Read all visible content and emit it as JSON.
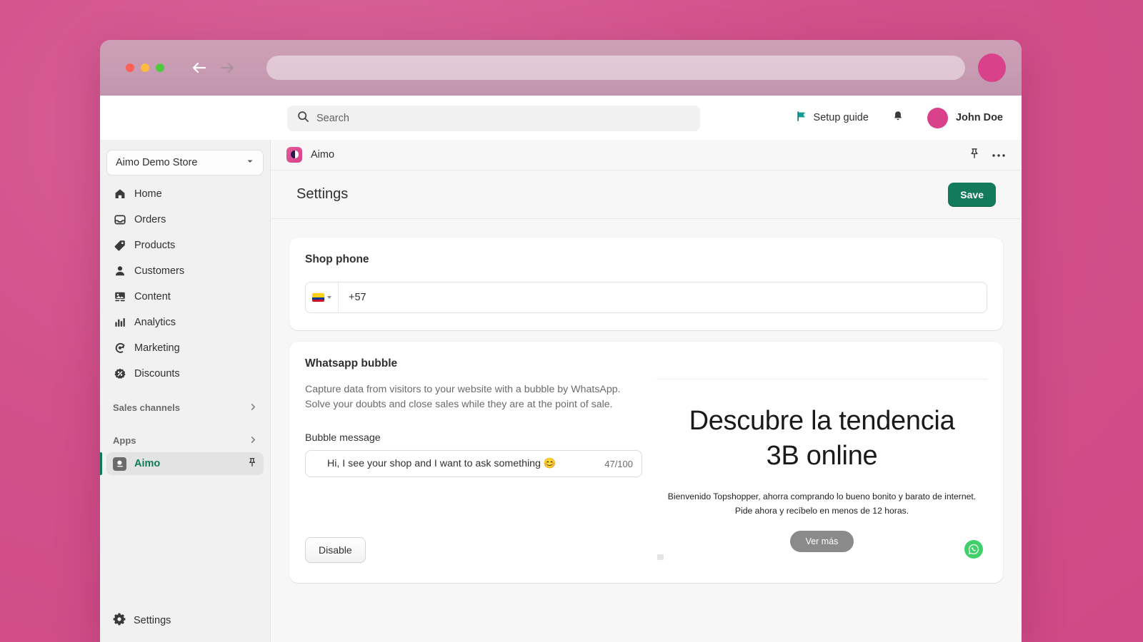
{
  "browser": {
    "back_arrow_icon": "arrow-left-icon",
    "forward_arrow_icon": "arrow-right-icon",
    "url_value": "",
    "url_placeholder": ""
  },
  "topbar": {
    "search": {
      "placeholder": "Search",
      "value": "",
      "icon": "search-icon"
    },
    "setup_guide_label": "Setup guide",
    "setup_guide_icon": "flag-icon",
    "notifications_icon": "bell-icon",
    "user_name": "John Doe",
    "avatar_color": "#d9418a"
  },
  "sidebar": {
    "store_selector": {
      "label": "Aimo Demo Store",
      "chevron_icon": "chevron-down-icon"
    },
    "items": [
      {
        "label": "Home",
        "icon": "home-icon"
      },
      {
        "label": "Orders",
        "icon": "orders-inbox-icon"
      },
      {
        "label": "Products",
        "icon": "tag-icon"
      },
      {
        "label": "Customers",
        "icon": "person-icon"
      },
      {
        "label": "Content",
        "icon": "image-icon"
      },
      {
        "label": "Analytics",
        "icon": "bar-chart-icon"
      },
      {
        "label": "Marketing",
        "icon": "megaphone-target-icon"
      },
      {
        "label": "Discounts",
        "icon": "discount-percent-icon"
      }
    ],
    "sections": [
      {
        "label": "Sales channels",
        "chevron_icon": "chevron-right-icon"
      },
      {
        "label": "Apps",
        "chevron_icon": "chevron-right-icon"
      }
    ],
    "app_item": {
      "label": "Aimo",
      "icon": "aimo-app-icon",
      "pin_icon": "pin-icon",
      "selected": true,
      "accent": "#0f7a5a"
    },
    "settings_item": {
      "label": "Settings",
      "icon": "gear-icon"
    }
  },
  "app_header": {
    "title": "Aimo",
    "icon": "aimo-app-icon",
    "pin_icon": "pin-icon",
    "more_icon": "ellipsis-icon"
  },
  "page": {
    "title": "Settings",
    "save_label": "Save",
    "save_color": "#137a5b"
  },
  "shop_phone": {
    "title": "Shop phone",
    "country_flag": "flag-colombia-icon",
    "country_chevron_icon": "chevron-down-icon",
    "value": "+57",
    "placeholder": ""
  },
  "whatsapp_bubble": {
    "title": "Whatsapp bubble",
    "description": "Capture data from visitors to your website with a bubble by WhatsApp. Solve your doubts and close sales while they are at the point of sale.",
    "bubble_message_label": "Bubble message",
    "bubble_message_value": "Hi, I see your shop and I want to ask something 😊",
    "bubble_message_counter": "47/100",
    "disable_label": "Disable"
  },
  "preview": {
    "heading_line1": "Descubre la tendencia",
    "heading_line2": "3B online",
    "sub_line1": "Bienvenido Topshopper, ahorra comprando lo bueno bonito y barato de internet.",
    "sub_line2": "Pide ahora y recíbelo en menos de 12 horas.",
    "cta_label": "Ver más",
    "whatsapp_icon": "whatsapp-icon",
    "whatsapp_color": "#3fd06a"
  }
}
